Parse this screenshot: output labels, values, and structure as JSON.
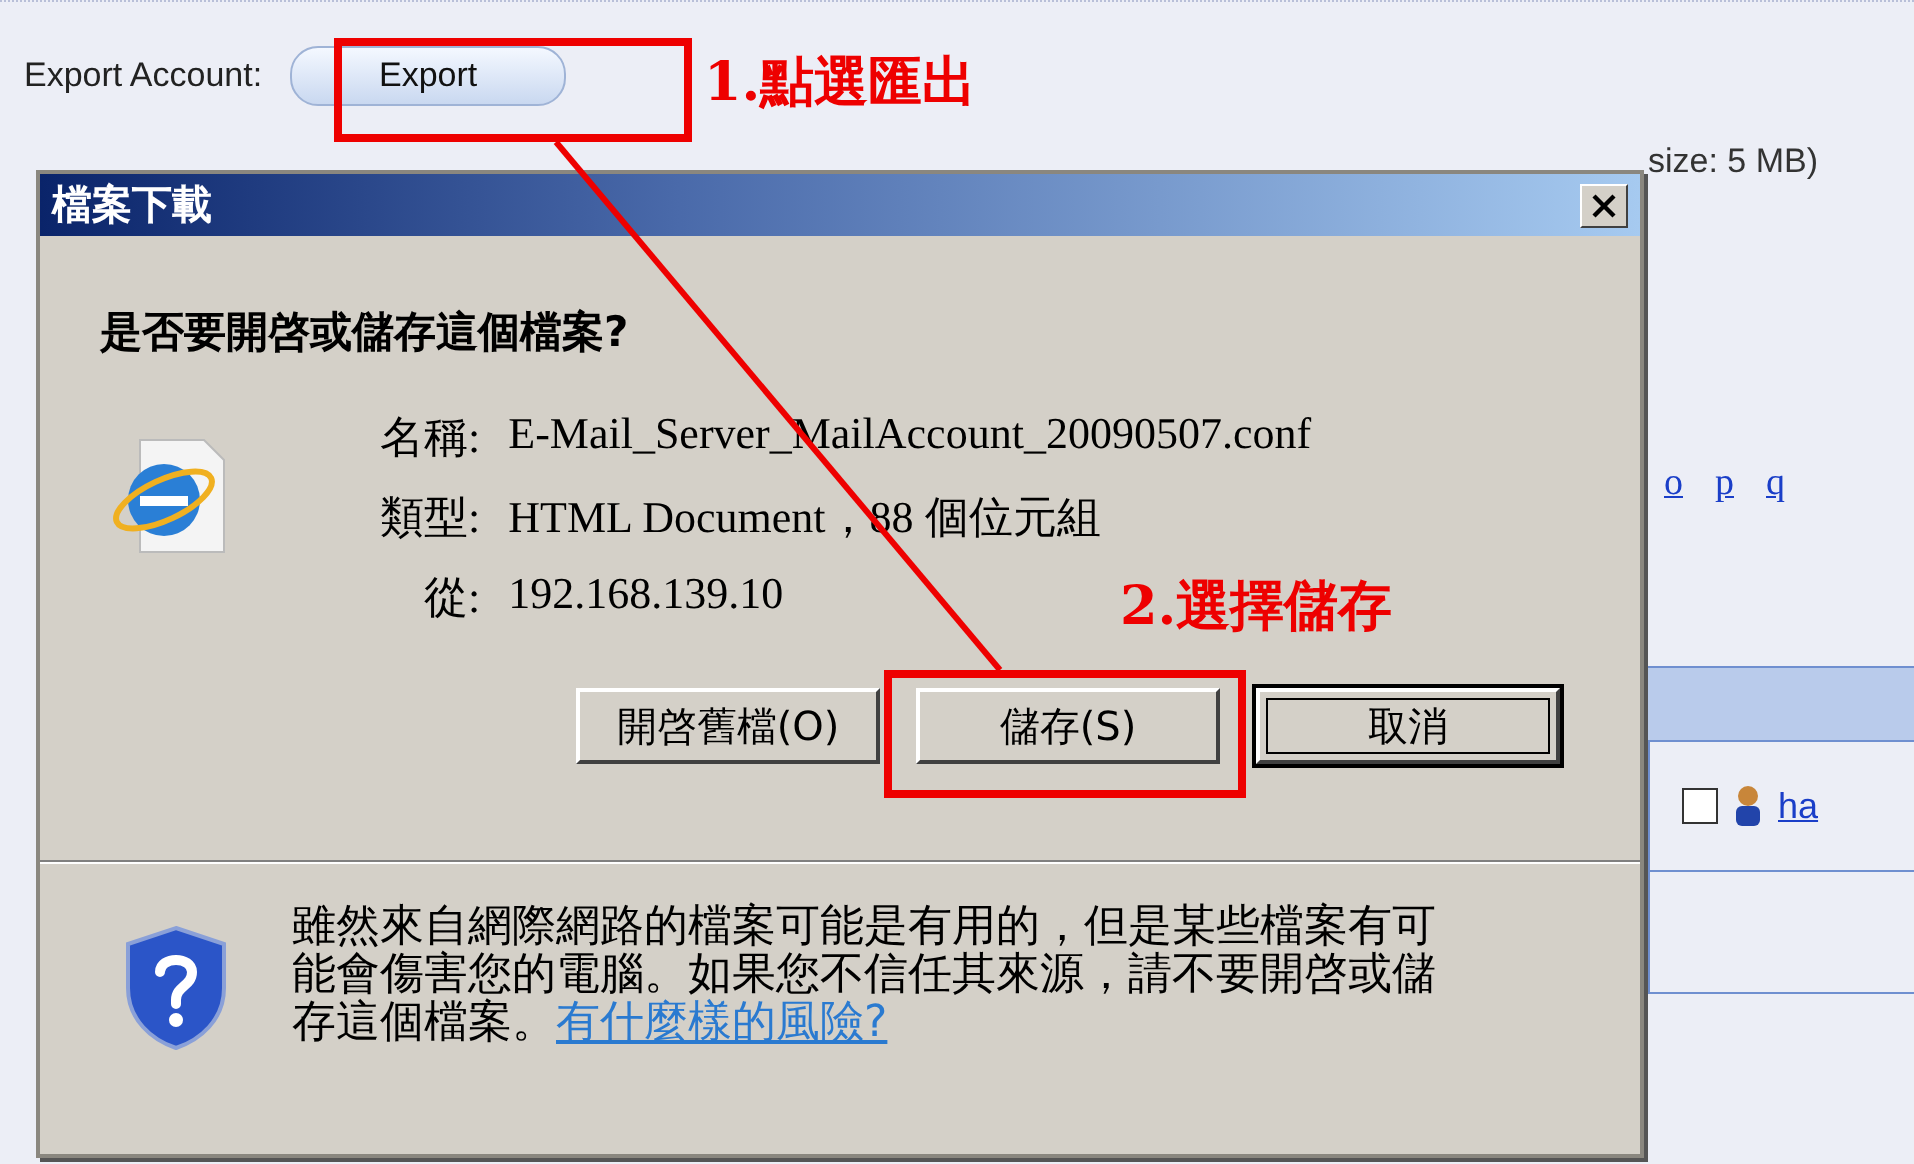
{
  "page": {
    "export_label": "Export Account:",
    "export_button": "Export",
    "upload_note": "size: 5 MB)",
    "letter_links": [
      "o",
      "p",
      "q"
    ],
    "table": {
      "rows": [
        {
          "checked": false,
          "user_link": "ha"
        }
      ]
    }
  },
  "dialog": {
    "title": "檔案下載",
    "question": "是否要開啓或儲存這個檔案?",
    "details": [
      {
        "label": "名稱:",
        "value": "E-Mail_Server_MailAccount_20090507.conf"
      },
      {
        "label": "類型:",
        "value": "HTML Document，88 個位元組"
      },
      {
        "label": "從:",
        "value": "192.168.139.10"
      }
    ],
    "buttons": [
      {
        "label": "開啓舊檔(O)",
        "default": false
      },
      {
        "label": "儲存(S)",
        "default": false
      },
      {
        "label": "取消",
        "default": true
      }
    ],
    "warning": {
      "text": "雖然來自網際網路的檔案可能是有用的，但是某些檔案有可能會傷害您的電腦。如果您不信任其來源，請不要開啓或儲存這個檔案。",
      "link": "有什麼樣的風險?"
    }
  },
  "annotations": [
    {
      "text": "1.點選匯出"
    },
    {
      "text": "2.選擇儲存"
    }
  ]
}
